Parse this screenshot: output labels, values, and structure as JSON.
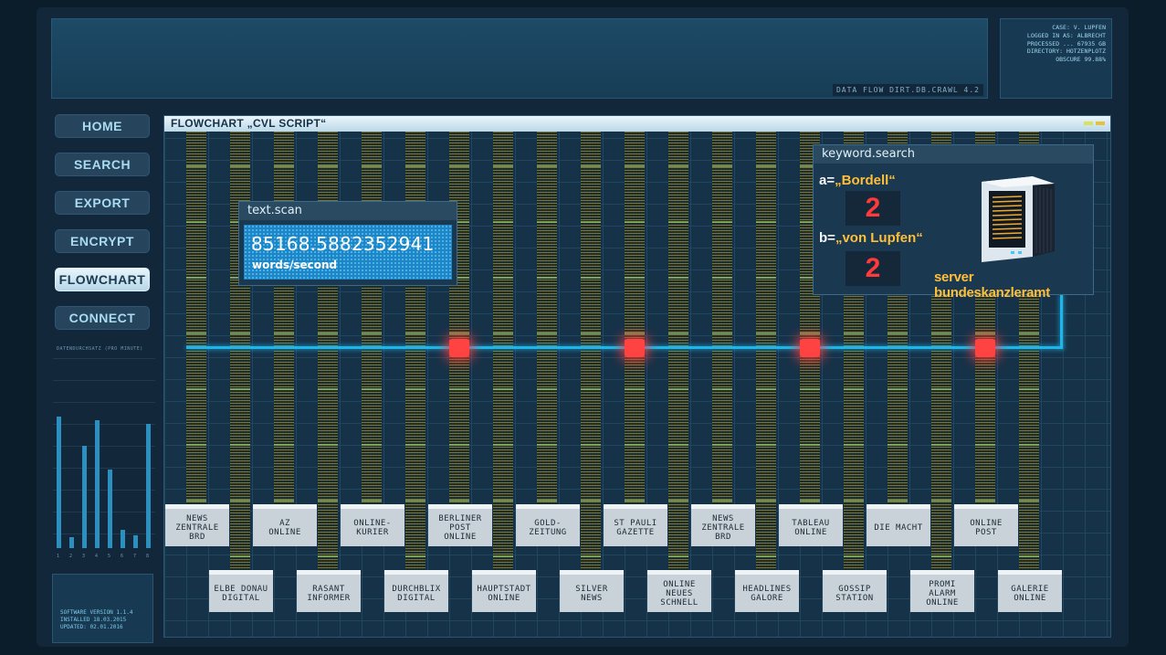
{
  "header": {
    "dataflow_label": "DATA FLOW DIRT.DB.CRAWL 4.2",
    "case_info": [
      "CASE: V. LUPFEN",
      "LOGGED IN AS: ALBRECHT",
      "PROCESSED ... 67935 GB",
      "DIRECTORY: HOTZENPLOTZ",
      "OBSCURE 99.88%"
    ]
  },
  "nav": {
    "items": [
      {
        "label": "HOME",
        "active": false
      },
      {
        "label": "SEARCH",
        "active": false
      },
      {
        "label": "EXPORT",
        "active": false
      },
      {
        "label": "ENCRYPT",
        "active": false
      },
      {
        "label": "FLOWCHART",
        "active": true
      },
      {
        "label": "CONNECT",
        "active": false
      }
    ]
  },
  "side_chart": {
    "caption": "DATENDURCHSATZ (PRO MINUTE)",
    "categories": [
      "1",
      "2",
      "3",
      "4",
      "5",
      "6",
      "7",
      "8"
    ],
    "values": [
      0.72,
      0.06,
      0.56,
      0.7,
      0.43,
      0.1,
      0.07,
      0.68
    ],
    "bar_color": "#2b8fbf"
  },
  "version": {
    "lines": [
      "SOFTWARE VERSION 1.1.4",
      "INSTALLED 18.03.2015",
      "UPDATED: 02.01.2016"
    ]
  },
  "flowchart": {
    "title": "FLOWCHART „CVL SCRIPT“",
    "line_color": "#1fb5e8",
    "node_color": "#ff4242",
    "sources_top": [
      "NEWS\nZENTRALE\nBRD",
      "AZ\nONLINE",
      "ONLINE-\nKURIER",
      "BERLINER\nPOST\nONLINE",
      "GOLD-\nZEITUNG",
      "ST PAULI\nGAZETTE",
      "NEWS\nZENTRALE\nBRD",
      "TABLEAU\nONLINE",
      "DIE MACHT",
      "ONLINE\nPOST"
    ],
    "sources_bottom": [
      "ELBE DONAU\nDIGITAL",
      "RASANT\nINFORMER",
      "DURCHBLIX\nDIGITAL",
      "HAUPTSTADT\nONLINE",
      "SILVER\nNEWS",
      "ONLINE\nNEUES\nSCHNELL",
      "HEADLINES\nGALORE",
      "GOSSIP\nSTATION",
      "PROMI\nALARM\nONLINE",
      "GALERIE\nONLINE"
    ]
  },
  "text_scan": {
    "title": "text.scan",
    "value": "85168.5882352941",
    "unit": "words/second"
  },
  "keyword_search": {
    "title": "keyword.search",
    "a_prefix": "a=",
    "a_term": "„Bordell“",
    "a_count": "2",
    "b_prefix": "b=",
    "b_term": "„von Lupfen“",
    "b_count": "2",
    "server_name": "server bundeskanzleramt",
    "accent_color": "#ffbf38",
    "count_color": "#ff3a3a"
  }
}
